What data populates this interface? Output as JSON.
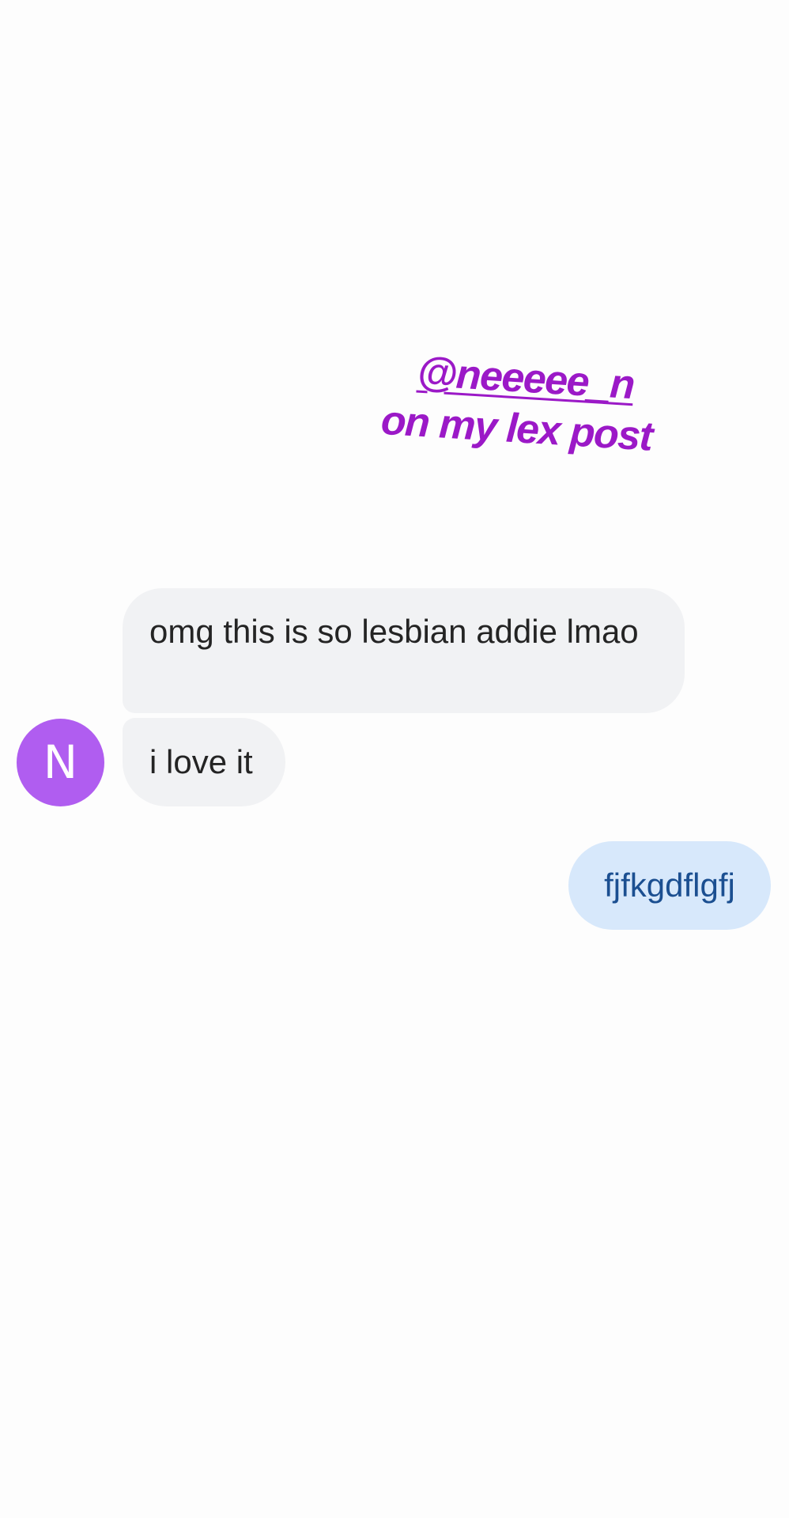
{
  "overlay": {
    "handle": "@neeeee_n",
    "caption": "on my lex post",
    "color": "#9b19c7"
  },
  "conversation": {
    "contact": {
      "avatar_initial": "N",
      "avatar_color": "#b05df0"
    },
    "messages": [
      {
        "direction": "incoming",
        "text": "omg this is so lesbian addie lmao"
      },
      {
        "direction": "incoming",
        "text": "i love it"
      },
      {
        "direction": "outgoing",
        "text": "fjfkgdflgfj"
      }
    ],
    "colors": {
      "incoming_bubble": "#f1f2f4",
      "outgoing_bubble": "#d7e8fb",
      "outgoing_text": "#1b4f91"
    }
  }
}
